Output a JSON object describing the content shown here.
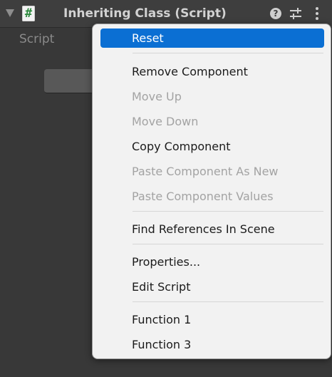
{
  "header": {
    "title": "Inheriting Class (Script)",
    "script_icon_glyph": "#",
    "help_glyph": "?",
    "icons": [
      "foldout-arrow-icon",
      "csharp-script-icon",
      "help-icon",
      "presets-icon",
      "kebab-menu-icon"
    ]
  },
  "inspector": {
    "script_label": "Script"
  },
  "context_menu": {
    "items": [
      {
        "label": "Reset",
        "state": "highlighted"
      },
      {
        "label": "Remove Component",
        "state": "enabled"
      },
      {
        "label": "Move Up",
        "state": "disabled"
      },
      {
        "label": "Move Down",
        "state": "disabled"
      },
      {
        "label": "Copy Component",
        "state": "enabled"
      },
      {
        "label": "Paste Component As New",
        "state": "disabled"
      },
      {
        "label": "Paste Component Values",
        "state": "disabled"
      },
      {
        "label": "Find References In Scene",
        "state": "enabled"
      },
      {
        "label": "Properties...",
        "state": "enabled"
      },
      {
        "label": "Edit Script",
        "state": "enabled"
      },
      {
        "label": "Function 1",
        "state": "enabled"
      },
      {
        "label": "Function 3",
        "state": "enabled"
      }
    ]
  },
  "colors": {
    "highlight": "#0b6fd3",
    "menu_background": "#f2f2f2",
    "disabled_text": "#a3a3a3",
    "panel_background": "#383838"
  }
}
